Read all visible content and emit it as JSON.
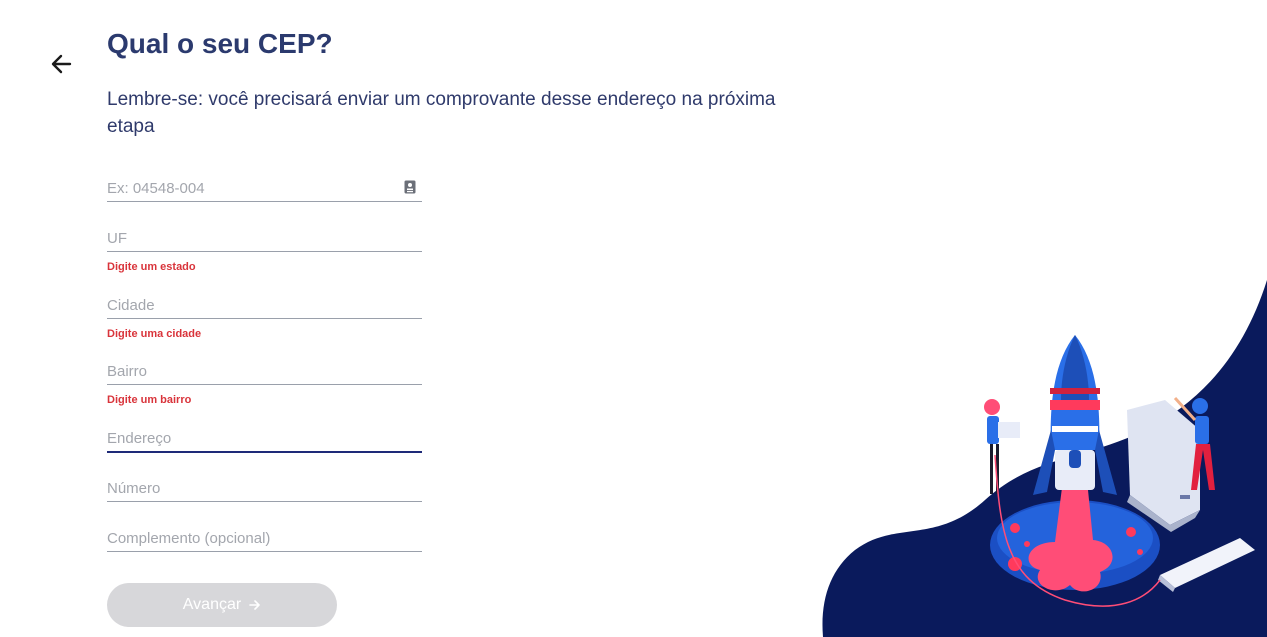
{
  "header": {
    "title": "Qual o seu CEP?",
    "subtitle": "Lembre-se: você precisará enviar um comprovante desse endereço na próxima etapa"
  },
  "form": {
    "cep": {
      "placeholder": "Ex: 04548-004",
      "value": ""
    },
    "uf": {
      "placeholder": "UF",
      "value": "",
      "error": "Digite um estado"
    },
    "cidade": {
      "placeholder": "Cidade",
      "value": "",
      "error": "Digite uma cidade"
    },
    "bairro": {
      "placeholder": "Bairro",
      "value": "",
      "error": "Digite um bairro"
    },
    "endereco": {
      "placeholder": "Endereço",
      "value": ""
    },
    "numero": {
      "placeholder": "Número",
      "value": ""
    },
    "complemento": {
      "placeholder": "Complemento (opcional)",
      "value": ""
    }
  },
  "actions": {
    "advance_label": "Avançar"
  },
  "icons": {
    "back": "arrow-left-icon",
    "cep_card": "address-card-icon",
    "advance": "arrow-right-icon"
  },
  "colors": {
    "title": "#2b3a6e",
    "error": "#d9343b",
    "focus_underline": "#1e2a78",
    "button_disabled": "#d7d7da",
    "blob": "#0a1a5c"
  }
}
